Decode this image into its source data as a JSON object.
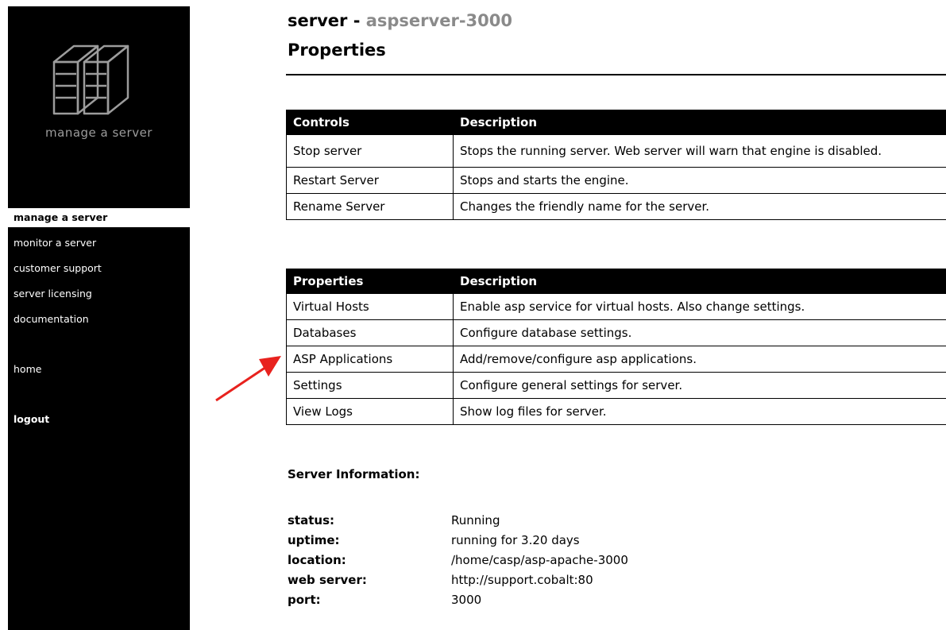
{
  "sidebar": {
    "logo_caption": "manage a server",
    "items": [
      {
        "label": "manage a server"
      },
      {
        "label": "monitor a server"
      },
      {
        "label": "customer support"
      },
      {
        "label": "server licensing"
      },
      {
        "label": "documentation"
      },
      {
        "label": "home"
      },
      {
        "label": "logout"
      }
    ]
  },
  "header": {
    "title_prefix": "server - ",
    "server_name": "aspserver-3000",
    "subtitle": "Properties"
  },
  "controls_table": {
    "headers": [
      "Controls",
      "Description"
    ],
    "rows": [
      {
        "name": "Stop server",
        "description": "Stops the running server. Web server will warn that engine is disabled."
      },
      {
        "name": "Restart Server",
        "description": "Stops and starts the engine."
      },
      {
        "name": "Rename Server",
        "description": "Changes the friendly name for the server."
      }
    ]
  },
  "properties_table": {
    "headers": [
      "Properties",
      "Description"
    ],
    "rows": [
      {
        "name": "Virtual Hosts",
        "description": "Enable asp service for virtual hosts. Also change settings."
      },
      {
        "name": "Databases",
        "description": "Configure database settings."
      },
      {
        "name": "ASP Applications",
        "description": "Add/remove/configure asp applications."
      },
      {
        "name": "Settings",
        "description": "Configure general settings for server."
      },
      {
        "name": "View Logs",
        "description": "Show log files for server."
      }
    ]
  },
  "server_info": {
    "heading": "Server Information:",
    "rows": [
      {
        "key": "status:",
        "value": "Running"
      },
      {
        "key": "uptime:",
        "value": "running for 3.20 days"
      },
      {
        "key": "location:",
        "value": "/home/casp/asp-apache-3000"
      },
      {
        "key": "web server:",
        "value": "http://support.cobalt:80"
      },
      {
        "key": "port:",
        "value": "3000"
      }
    ]
  },
  "colors": {
    "sidebar_bg": "#000000",
    "accent_grey": "#8a8a8a",
    "arrow": "#e8221e"
  }
}
